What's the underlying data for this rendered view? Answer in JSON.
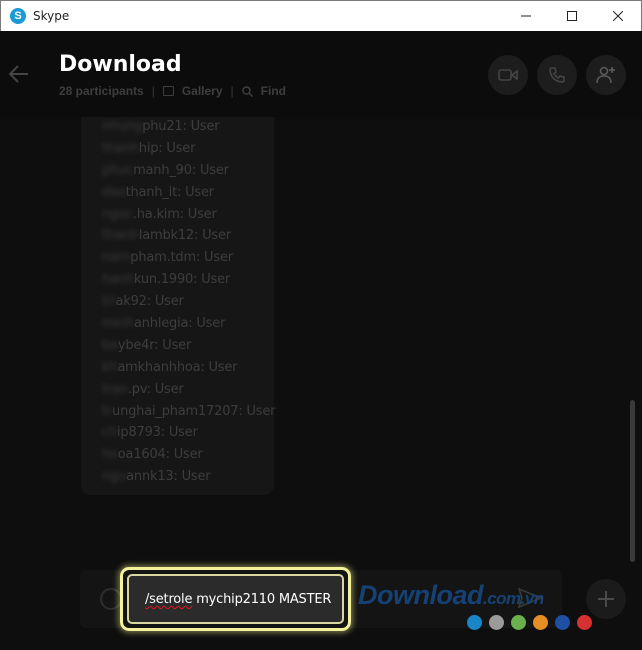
{
  "window": {
    "app_icon": "skype-icon",
    "app_icon_glyph": "S",
    "title": "Skype",
    "controls": [
      "minimize-icon",
      "maximize-icon",
      "close-icon"
    ]
  },
  "header": {
    "title": "Download",
    "participants": "28 participants",
    "gallery_label": "Gallery",
    "find_label": "Find",
    "buttons": [
      "video-call-icon",
      "audio-call-icon",
      "add-participant-icon"
    ]
  },
  "members": [
    {
      "hidden": "nhung",
      "visible": "phu21: User"
    },
    {
      "hidden": "thanh",
      "visible": "hip: User"
    },
    {
      "hidden": "phuc",
      "visible": "manh_90: User"
    },
    {
      "hidden": "dao",
      "visible": "thanh_it: User"
    },
    {
      "hidden": "ngoc",
      "visible": ".ha.kim: User"
    },
    {
      "hidden": "thanh",
      "visible": "lambk12: User"
    },
    {
      "hidden": "nam",
      "visible": "pham.tdm: User"
    },
    {
      "hidden": "hanh",
      "visible": "kun.1990: User"
    },
    {
      "hidden": "tri",
      "visible": "ak92: User"
    },
    {
      "hidden": "minh",
      "visible": "anhlegia: User"
    },
    {
      "hidden": "ba",
      "visible": "ybe4r: User"
    },
    {
      "hidden": "kh",
      "visible": "amkhanhhoa: User"
    },
    {
      "hidden": "tran",
      "visible": ".pv: User"
    },
    {
      "hidden": "tr",
      "visible": "unghai_pham17207: User"
    },
    {
      "hidden": "ch",
      "visible": "ip8793: User"
    },
    {
      "hidden": "ho",
      "visible": "oa1604: User"
    },
    {
      "hidden": "ngu",
      "visible": "annk13: User"
    }
  ],
  "composer": {
    "emoji_icon": "emoji-icon",
    "command": "/setrole",
    "rest": " mychip2110 MASTER",
    "send_icon": "send-icon",
    "add_icon": "plus-icon"
  },
  "watermark": {
    "text": "Download",
    "suffix": ".com.vn",
    "dot_colors": [
      "#1a86c8",
      "#9a9a9a",
      "#6ab04c",
      "#e58e26",
      "#1e4fa3",
      "#d63031"
    ]
  }
}
